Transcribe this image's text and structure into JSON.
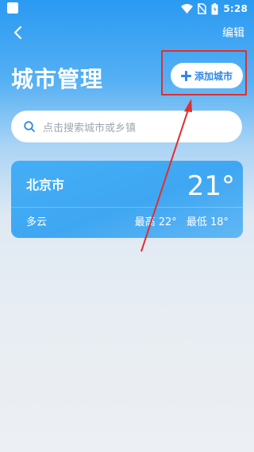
{
  "status_bar": {
    "time": "5:28",
    "icons": [
      "app-square-icon",
      "wifi-icon",
      "no-sim-icon",
      "battery-icon"
    ]
  },
  "nav": {
    "back_icon": "chevron-left-icon",
    "edit_label": "编辑"
  },
  "page_title": "城市管理",
  "add_city": {
    "label": "添加城市",
    "icon": "plus-icon"
  },
  "search": {
    "placeholder": "点击搜索城市或乡镇",
    "icon": "search-icon"
  },
  "cities": [
    {
      "name": "北京市",
      "temperature": "21°",
      "condition": "多云",
      "high": "最高 22°",
      "low": "最低 18°"
    }
  ],
  "colors": {
    "accent": "#2e87e8",
    "card": "#43aef6",
    "annotation": "#e02f2f"
  }
}
